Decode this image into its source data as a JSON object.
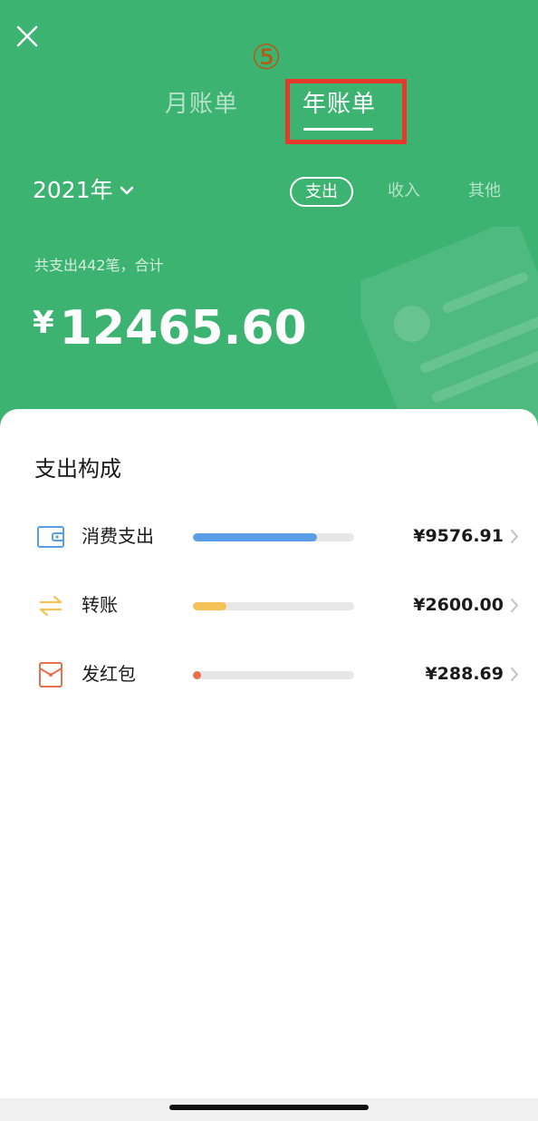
{
  "header": {
    "step_marker": "⑤",
    "tabs": [
      {
        "label": "月账单",
        "active": false
      },
      {
        "label": "年账单",
        "active": true
      }
    ],
    "year_label": "2021年",
    "filters": [
      {
        "label": "支出",
        "active": true
      },
      {
        "label": "收入",
        "active": false
      },
      {
        "label": "其他",
        "active": false
      }
    ],
    "summary_caption": "共支出442笔，合计",
    "currency_symbol": "¥",
    "total_amount": "12465.60"
  },
  "breakdown": {
    "title": "支出构成",
    "items": [
      {
        "label": "消费支出",
        "value": "¥9576.91",
        "share": 0.768,
        "color": "#5b9ee8",
        "icon": "wallet-icon"
      },
      {
        "label": "转账",
        "value": "¥2600.00",
        "share": 0.209,
        "color": "#f5c25a",
        "icon": "transfer-icon"
      },
      {
        "label": "发红包",
        "value": "¥288.69",
        "share": 0.023,
        "color": "#e8704f",
        "icon": "red-packet-icon"
      }
    ]
  },
  "colors": {
    "header_green": "#3cb371",
    "highlight_red": "#e43a2c"
  }
}
